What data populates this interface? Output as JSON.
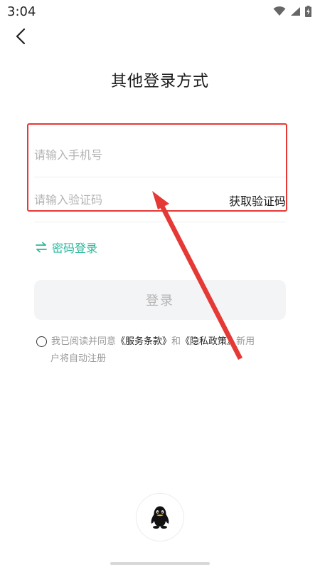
{
  "status_bar": {
    "time": "3:04"
  },
  "page": {
    "title": "其他登录方式"
  },
  "form": {
    "phone_placeholder": "请输入手机号",
    "code_placeholder": "请输入验证码",
    "get_code_label": "获取验证码"
  },
  "password_login_label": "密码登录",
  "login_button_label": "登录",
  "agreement": {
    "prefix": "我已阅读并同意",
    "terms": "《服务条款》",
    "and": "和",
    "privacy": "《隐私政策》",
    "suffix_line1": "新用",
    "suffix_line2": "户将自动注册"
  },
  "icons": {
    "back": "chevron-left-icon",
    "switch": "swap-arrows-icon",
    "qq": "qq-penguin-icon",
    "wifi": "wifi-icon",
    "signal": "cellular-signal-icon",
    "battery": "battery-charging-icon"
  },
  "colors": {
    "accent": "#2bb79b",
    "annotation": "#e53935",
    "placeholder": "#b3b3b3",
    "button_bg": "#f3f4f6"
  }
}
